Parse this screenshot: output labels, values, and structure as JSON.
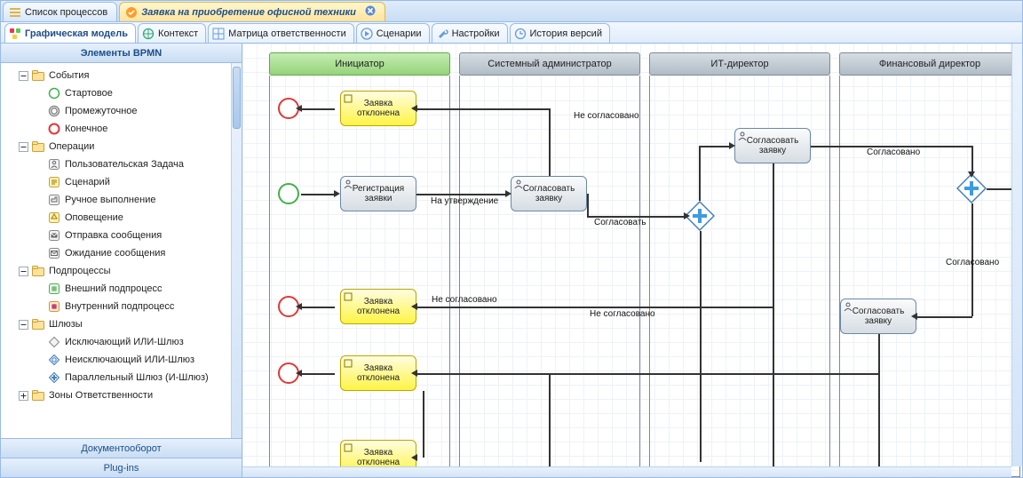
{
  "top_tabs": [
    {
      "label": "Список процессов",
      "icon": "list-icon"
    },
    {
      "label": "Заявка на приобретение офисной техники",
      "icon": "process-icon",
      "closable": true,
      "active": true
    }
  ],
  "sub_tabs": [
    {
      "label": "Графическая модель",
      "icon": "diagram-icon",
      "active": true
    },
    {
      "label": "Контекст",
      "icon": "globe-icon"
    },
    {
      "label": "Матрица ответственности",
      "icon": "grid-icon"
    },
    {
      "label": "Сценарии",
      "icon": "play-icon"
    },
    {
      "label": "Настройки",
      "icon": "wrench-icon"
    },
    {
      "label": "История версий",
      "icon": "history-icon"
    }
  ],
  "side": {
    "title": "Элементы BPMN",
    "footers": [
      "Документооборот",
      "Plug-ins"
    ],
    "nodes": [
      {
        "kind": "folder",
        "level": 1,
        "expanded": true,
        "label": "События"
      },
      {
        "kind": "leaf",
        "level": 2,
        "label": "Стартовое",
        "icon": "start-event-icon"
      },
      {
        "kind": "leaf",
        "level": 2,
        "label": "Промежуточное",
        "icon": "intermediate-event-icon"
      },
      {
        "kind": "leaf",
        "level": 2,
        "label": "Конечное",
        "icon": "end-event-icon"
      },
      {
        "kind": "folder",
        "level": 1,
        "expanded": true,
        "label": "Операции"
      },
      {
        "kind": "leaf",
        "level": 2,
        "label": "Пользовательская Задача",
        "icon": "user-task-icon"
      },
      {
        "kind": "leaf",
        "level": 2,
        "label": "Сценарий",
        "icon": "script-task-icon"
      },
      {
        "kind": "leaf",
        "level": 2,
        "label": "Ручное выполнение",
        "icon": "manual-task-icon"
      },
      {
        "kind": "leaf",
        "level": 2,
        "label": "Оповещение",
        "icon": "notify-task-icon"
      },
      {
        "kind": "leaf",
        "level": 2,
        "label": "Отправка сообщения",
        "icon": "send-task-icon"
      },
      {
        "kind": "leaf",
        "level": 2,
        "label": "Ожидание сообщения",
        "icon": "receive-task-icon"
      },
      {
        "kind": "folder",
        "level": 1,
        "expanded": true,
        "label": "Подпроцессы"
      },
      {
        "kind": "leaf",
        "level": 2,
        "label": "Внешний подпроцесс",
        "icon": "ext-subprocess-icon"
      },
      {
        "kind": "leaf",
        "level": 2,
        "label": "Внутренний подпроцесс",
        "icon": "int-subprocess-icon"
      },
      {
        "kind": "folder",
        "level": 1,
        "expanded": true,
        "label": "Шлюзы"
      },
      {
        "kind": "leaf",
        "level": 2,
        "label": "Исключающий ИЛИ-Шлюз",
        "icon": "xor-gateway-icon"
      },
      {
        "kind": "leaf",
        "level": 2,
        "label": "Неисключающий ИЛИ-Шлюз",
        "icon": "or-gateway-icon"
      },
      {
        "kind": "leaf",
        "level": 2,
        "label": "Параллельный Шлюз (И-Шлюз)",
        "icon": "and-gateway-icon"
      },
      {
        "kind": "folder",
        "level": 1,
        "expanded": false,
        "label": "Зоны Ответственности"
      }
    ]
  },
  "lanes": [
    "Инициатор",
    "Системный администратор",
    "ИТ-директор",
    "Финансовый директор"
  ],
  "diagram": {
    "task_reg": "Регистрация заявки",
    "task_reject": "Заявка отклонена",
    "task_approve": "Согласовать заявку",
    "lbl_to_approval": "На утверждение",
    "lbl_approve": "Согласовать",
    "lbl_approved": "Согласовано",
    "lbl_not_approved": "Не согласовано"
  }
}
